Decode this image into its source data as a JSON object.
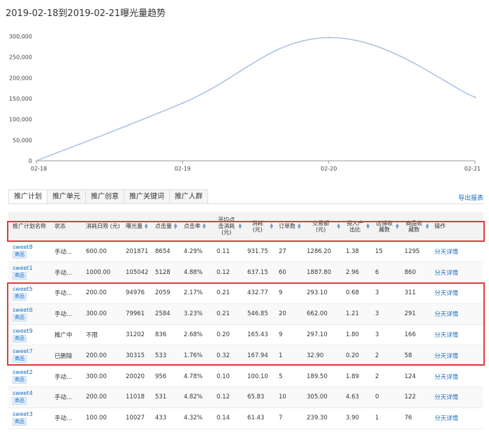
{
  "title": "2019-02-18到2019-02-21曝光量趋势",
  "chart_data": {
    "type": "line",
    "x": [
      "02-18",
      "02-19",
      "02-20",
      "02-21"
    ],
    "series": [
      {
        "values": [
          0,
          139000,
          297000,
          153000
        ]
      }
    ],
    "ylim": [
      0,
      300000
    ],
    "yticks": [
      "0",
      "50,000",
      "100,000",
      "150,000",
      "200,000",
      "250,000",
      "300,000"
    ],
    "ytick_values": [
      0,
      50000,
      100000,
      150000,
      200000,
      250000,
      300000
    ],
    "line_color": "#a9c1df",
    "grid": false,
    "smooth": true
  },
  "tabs": [
    {
      "label": "推广计划",
      "active": true
    },
    {
      "label": "推广单元"
    },
    {
      "label": "推广创意"
    },
    {
      "label": "推广关键词"
    },
    {
      "label": "推广人群"
    }
  ],
  "export_label": "导出报表",
  "table": {
    "columns": [
      {
        "label": "推广计划名称",
        "sortable": false
      },
      {
        "label": "状态",
        "sortable": false
      },
      {
        "label": "消耗日限 (元)",
        "sortable": false
      },
      {
        "label": "曝光量",
        "sortable": true
      },
      {
        "label": "点击量",
        "sortable": true
      },
      {
        "label": "点击率",
        "sortable": true
      },
      {
        "label": "平均点击消耗 (元)",
        "sortable": true
      },
      {
        "label": "消耗 (元)",
        "sortable": true
      },
      {
        "label": "订单数",
        "sortable": true
      },
      {
        "label": "交易额 (元)",
        "sortable": true
      },
      {
        "label": "投入产出比",
        "sortable": true
      },
      {
        "label": "店铺收藏数",
        "sortable": true
      },
      {
        "label": "商品收藏数",
        "sortable": true
      },
      {
        "label": "操作",
        "sortable": false
      }
    ],
    "tag_label": "商品",
    "action_label": "分天详情",
    "rows": [
      {
        "name": "sweet8",
        "status": "手动...",
        "limit": "600.00",
        "impressions": "201871",
        "clicks": "8654",
        "ctr": "4.29%",
        "cpc": "0.11",
        "cost": "931.75",
        "orders": "27",
        "gmv": "1286.20",
        "roi": "1.38",
        "shop_fav": "15",
        "item_fav": "1295"
      },
      {
        "name": "sweet1",
        "status": "手动...",
        "limit": "1000.00",
        "impressions": "105042",
        "clicks": "5128",
        "ctr": "4.88%",
        "cpc": "0.12",
        "cost": "637.15",
        "orders": "60",
        "gmv": "1887.80",
        "roi": "2.96",
        "shop_fav": "6",
        "item_fav": "860"
      },
      {
        "name": "sweet5",
        "status": "手动...",
        "limit": "200.00",
        "impressions": "94976",
        "clicks": "2059",
        "ctr": "2.17%",
        "cpc": "0.21",
        "cost": "432.77",
        "orders": "9",
        "gmv": "293.10",
        "roi": "0.68",
        "shop_fav": "3",
        "item_fav": "311"
      },
      {
        "name": "sweet6",
        "status": "手动...",
        "limit": "300.00",
        "impressions": "79961",
        "clicks": "2584",
        "ctr": "3.23%",
        "cpc": "0.21",
        "cost": "546.85",
        "orders": "20",
        "gmv": "662.00",
        "roi": "1.21",
        "shop_fav": "3",
        "item_fav": "291"
      },
      {
        "name": "sweet9",
        "status": "推广中",
        "limit": "不限",
        "impressions": "31202",
        "clicks": "836",
        "ctr": "2.68%",
        "cpc": "0.20",
        "cost": "165.43",
        "orders": "9",
        "gmv": "297.10",
        "roi": "1.80",
        "shop_fav": "3",
        "item_fav": "166"
      },
      {
        "name": "sweet7",
        "status": "已删除",
        "limit": "200.00",
        "impressions": "30315",
        "clicks": "533",
        "ctr": "1.76%",
        "cpc": "0.32",
        "cost": "167.94",
        "orders": "1",
        "gmv": "32.90",
        "roi": "0.20",
        "shop_fav": "2",
        "item_fav": "58"
      },
      {
        "name": "sweet2",
        "status": "手动...",
        "limit": "300.00",
        "impressions": "20020",
        "clicks": "956",
        "ctr": "4.78%",
        "cpc": "0.10",
        "cost": "100.10",
        "orders": "5",
        "gmv": "189.50",
        "roi": "1.89",
        "shop_fav": "2",
        "item_fav": "124"
      },
      {
        "name": "sweet4",
        "status": "手动...",
        "limit": "200.00",
        "impressions": "11018",
        "clicks": "531",
        "ctr": "4.82%",
        "cpc": "0.12",
        "cost": "65.83",
        "orders": "10",
        "gmv": "305.00",
        "roi": "4.63",
        "shop_fav": "0",
        "item_fav": "122"
      },
      {
        "name": "sweet3",
        "status": "手动...",
        "limit": "100.00",
        "impressions": "10027",
        "clicks": "433",
        "ctr": "4.32%",
        "cpc": "0.14",
        "cost": "61.43",
        "orders": "7",
        "gmv": "239.30",
        "roi": "3.90",
        "shop_fav": "1",
        "item_fav": "76"
      }
    ]
  },
  "highlight_color": "#e23a3a"
}
